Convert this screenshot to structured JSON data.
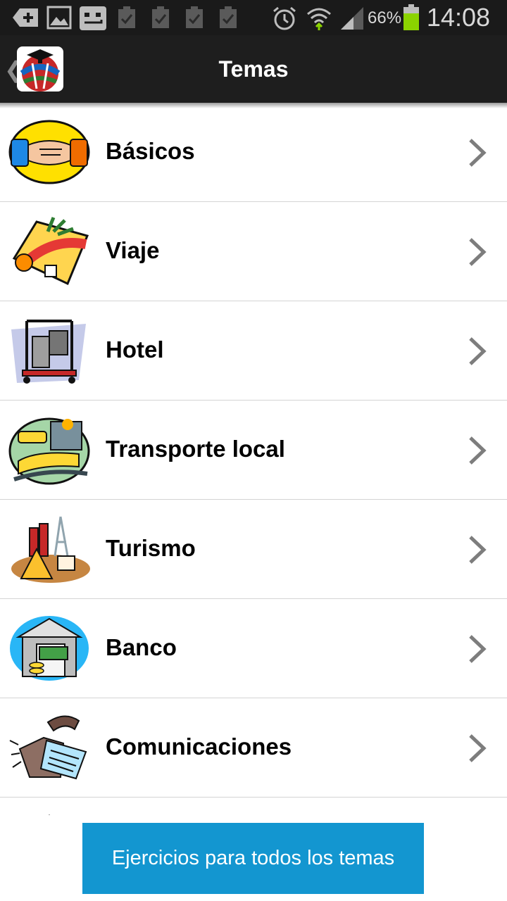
{
  "status_bar": {
    "battery_percent": "66%",
    "time": "14:08",
    "icons": [
      "add-icon",
      "image-icon",
      "message-icon",
      "task-check-icon",
      "task-check-icon",
      "task-check-icon",
      "task-check-icon",
      "alarm-icon",
      "wifi-icon",
      "signal-icon",
      "battery-icon"
    ]
  },
  "action_bar": {
    "title": "Temas",
    "back_icon": "chevron-left-icon",
    "logo_icon": "app-globe-logo-icon"
  },
  "topics": [
    {
      "label": "Básicos",
      "icon": "handshake-icon"
    },
    {
      "label": "Viaje",
      "icon": "travel-icon"
    },
    {
      "label": "Hotel",
      "icon": "luggage-cart-icon"
    },
    {
      "label": "Transporte local",
      "icon": "train-icon"
    },
    {
      "label": "Turismo",
      "icon": "landmarks-icon"
    },
    {
      "label": "Banco",
      "icon": "bank-icon"
    },
    {
      "label": "Comunicaciones",
      "icon": "telephone-icon"
    }
  ],
  "footer": {
    "button_label": "Ejercicios para todos los temas"
  },
  "colors": {
    "status_bar_bg": "#1a1a1a",
    "action_bar_bg": "#1e1e1e",
    "button_bg": "#1396d0",
    "battery_green": "#8bd300"
  }
}
